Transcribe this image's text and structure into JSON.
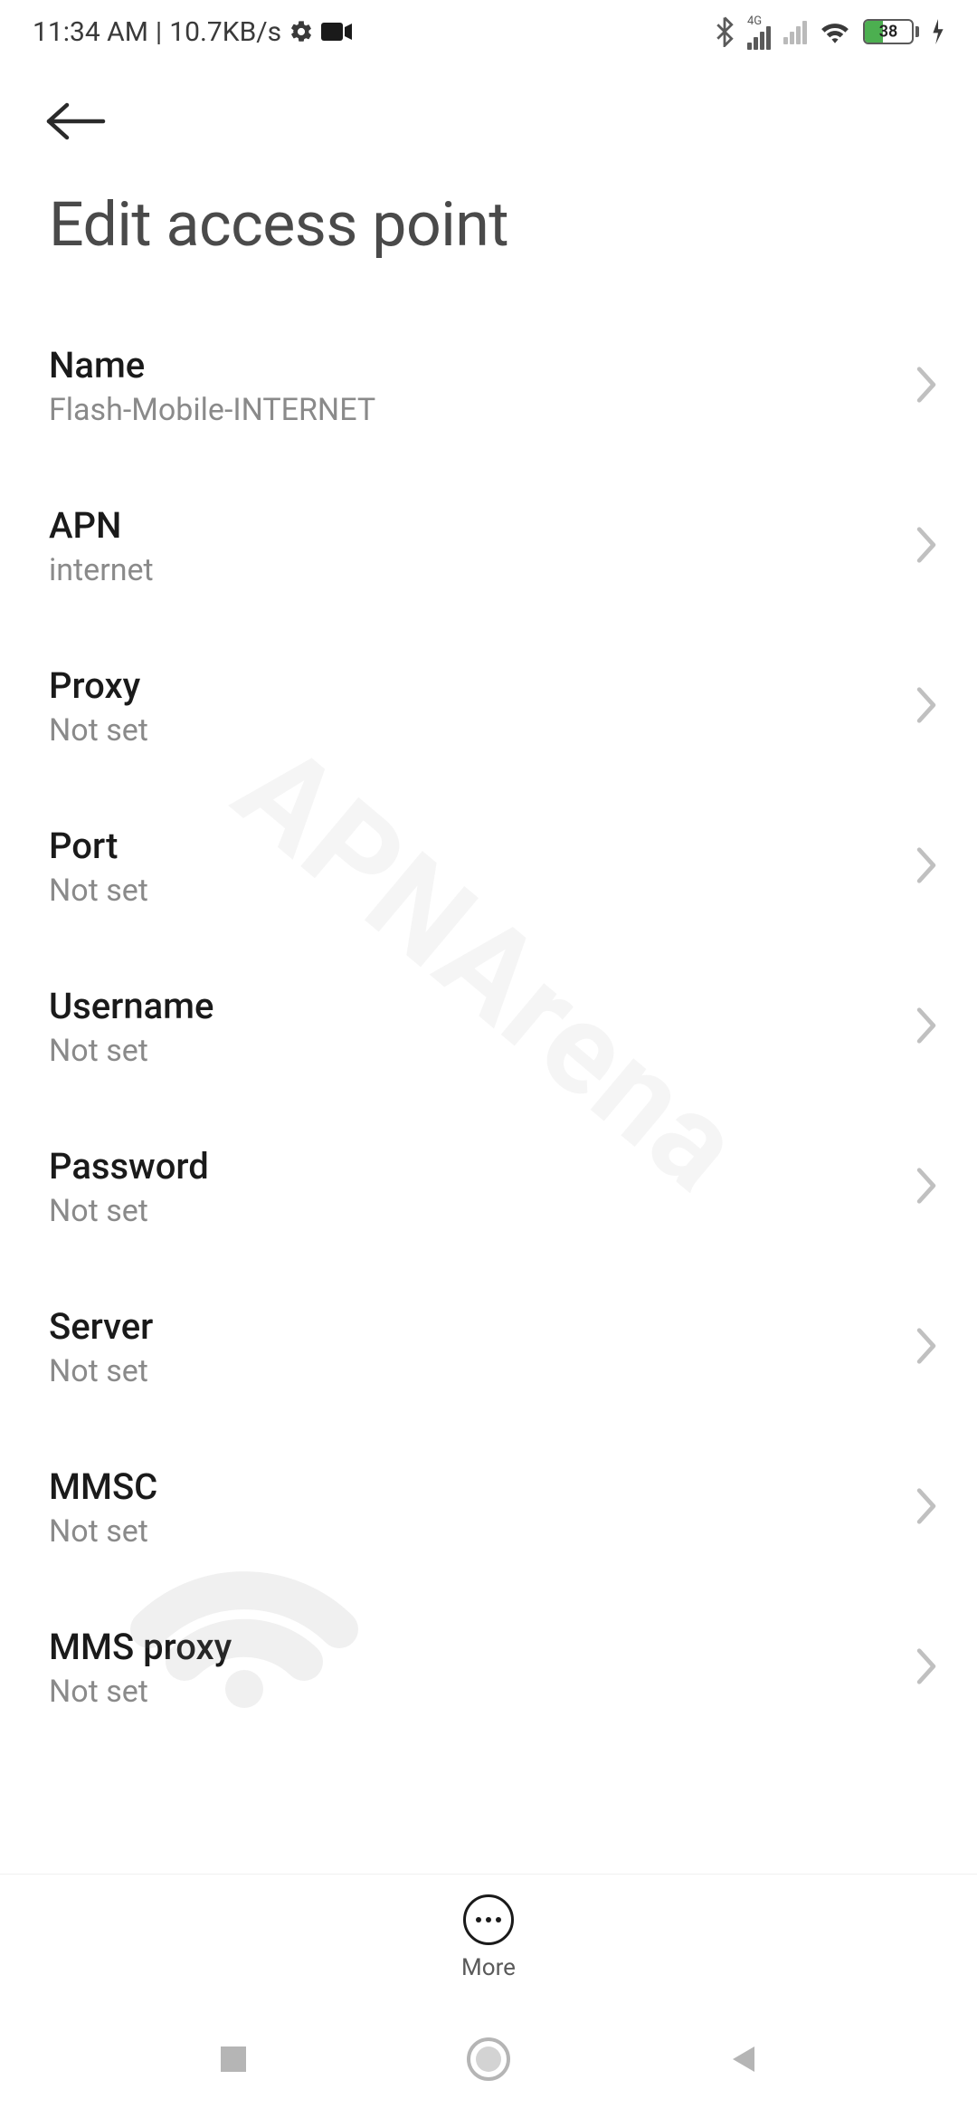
{
  "status": {
    "time": "11:34 AM",
    "separator": "|",
    "speed": "10.7KB/s",
    "battery_percent": "38",
    "network_label": "4G"
  },
  "header": {
    "title": "Edit access point"
  },
  "settings": {
    "items": [
      {
        "label": "Name",
        "value": "Flash-Mobile-INTERNET"
      },
      {
        "label": "APN",
        "value": "internet"
      },
      {
        "label": "Proxy",
        "value": "Not set"
      },
      {
        "label": "Port",
        "value": "Not set"
      },
      {
        "label": "Username",
        "value": "Not set"
      },
      {
        "label": "Password",
        "value": "Not set"
      },
      {
        "label": "Server",
        "value": "Not set"
      },
      {
        "label": "MMSC",
        "value": "Not set"
      },
      {
        "label": "MMS proxy",
        "value": "Not set"
      }
    ]
  },
  "bottom": {
    "more_label": "More"
  },
  "watermark": "APNArena"
}
